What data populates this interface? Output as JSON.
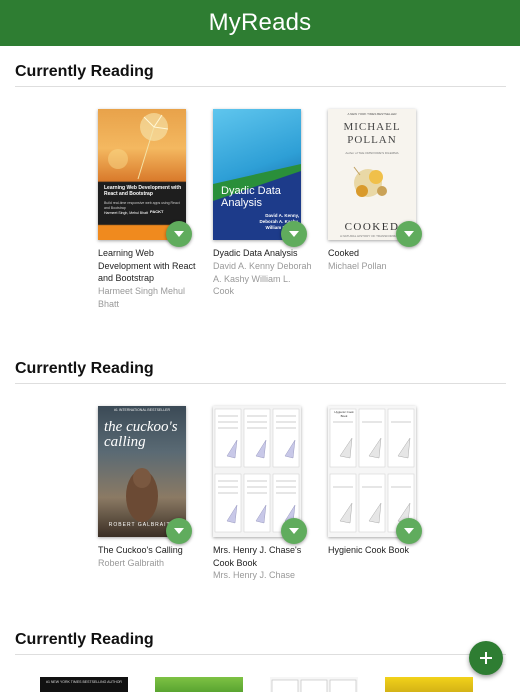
{
  "header": {
    "title": "MyReads"
  },
  "shelves": [
    {
      "title": "Currently Reading",
      "books": [
        {
          "title": "Learning Web Development with React and Bootstrap",
          "authors": "Harmeet Singh Mehul Bhatt"
        },
        {
          "title": "Dyadic Data Analysis",
          "authors": "David A. Kenny Deborah A. Kashy William L. Cook"
        },
        {
          "title": "Cooked",
          "authors": "Michael Pollan"
        }
      ]
    },
    {
      "title": "Currently Reading",
      "books": [
        {
          "title": "The Cuckoo's Calling",
          "authors": "Robert Galbraith"
        },
        {
          "title": "Mrs. Henry J. Chase's Cook Book",
          "authors": "Mrs. Henry J. Chase"
        },
        {
          "title": "Hygienic Cook Book",
          "authors": ""
        }
      ]
    },
    {
      "title": "Currently Reading",
      "books": []
    }
  ],
  "covers": {
    "react": {
      "heading": "Learning Web Development with React and Bootstrap",
      "blurb": "Build real-time responsive web apps using React and Bootstrap",
      "authors": "Harmeet Singh, Mehul Bhatt",
      "publisher": "PACKT"
    },
    "dyadic": {
      "title": "Dyadic Data Analysis",
      "authors": "David A. Kenny, Deborah A. Kashy, William L. Cook"
    },
    "cooked": {
      "tagline": "A NEW YORK TIMES BESTSELLER",
      "author": "MICHAEL POLLAN",
      "byline": "Author of THE OMNIVORE'S DILEMMA",
      "title": "COOKED",
      "subtitle": "A NATURAL HISTORY OF TRANSFORMATION"
    },
    "cuckoo": {
      "tagline": "#1 INTERNATIONAL BESTSELLER",
      "title": "the cuckoo's calling",
      "author": "ROBERT GALBRAITH"
    },
    "hygienic": {
      "label": "Hygienic Cook Book"
    },
    "row3_first": {
      "tagline": "#1 NEW YORK TIMES BESTSELLING AUTHOR"
    }
  },
  "colors": {
    "header": "#2e7d32",
    "changer": "#60ac5d",
    "fab": "#2e7d32"
  },
  "icons": {
    "changer": "triangle-down-icon",
    "fab": "plus-icon"
  }
}
